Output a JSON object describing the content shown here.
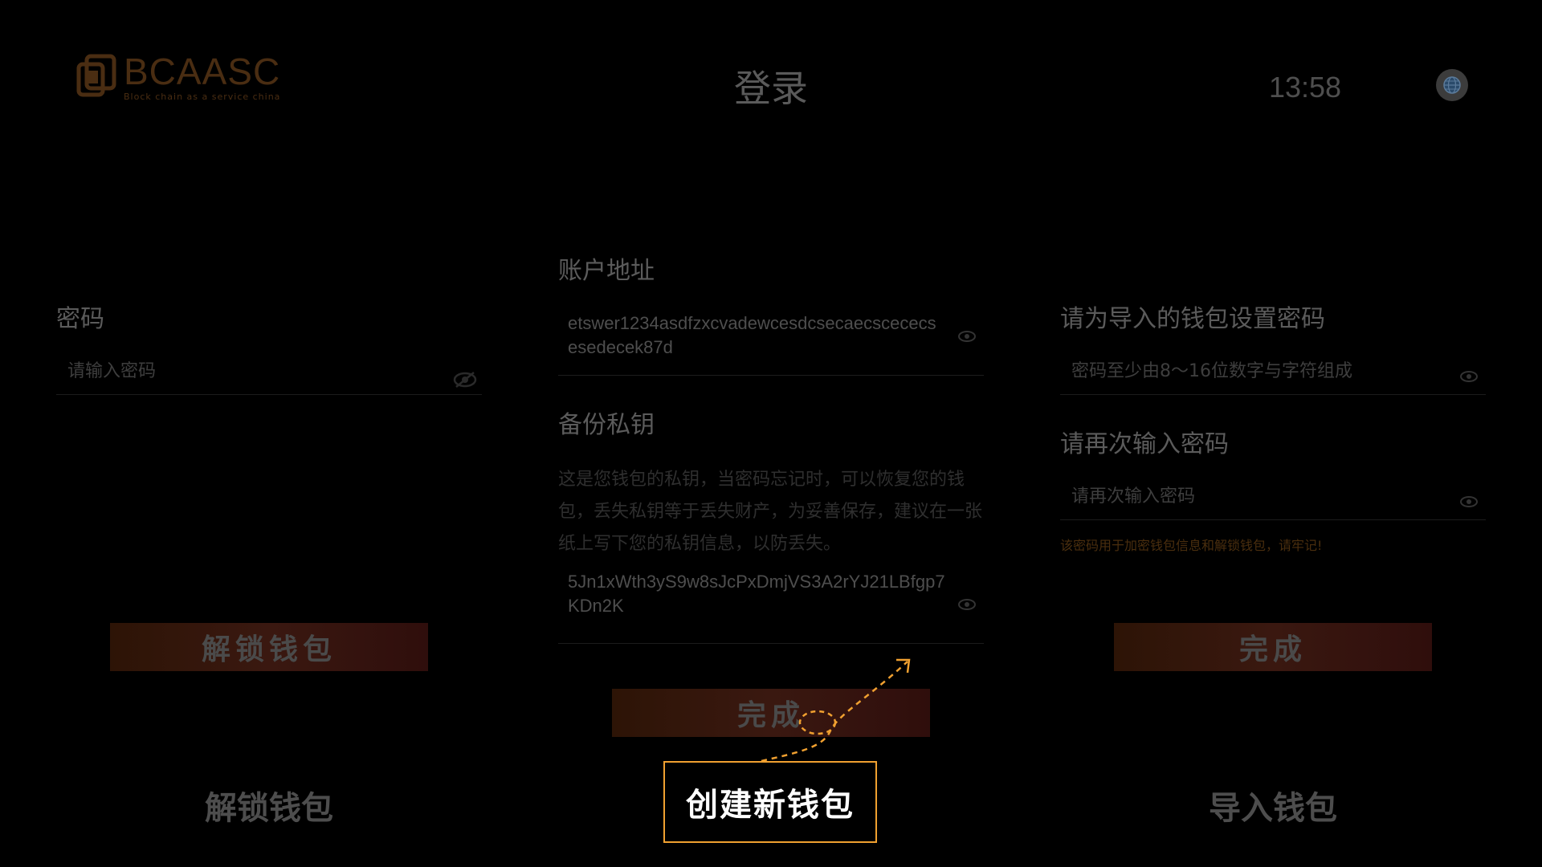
{
  "header": {
    "logo_name": "BCAASC",
    "logo_tagline": "Block chain as a service china",
    "title": "登录",
    "time": "13:58",
    "language_icon": "globe-icon"
  },
  "unlock_panel": {
    "password_label": "密码",
    "password_placeholder": "请输入密码",
    "unlock_button": "解锁钱包"
  },
  "create_panel": {
    "address_label": "账户地址",
    "address_value": "etswer1234asdfzxcvadewcesdcsecaecscececsesedecek87d",
    "backup_label": "备份私钥",
    "backup_description": "这是您钱包的私钥，当密码忘记时，可以恢复您的钱包，丢失私钥等于丢失财产，为妥善保存，建议在一张纸上写下您的私钥信息，以防丢失。",
    "private_key_value": "5Jn1xWth3yS9w8sJcPxDmjVS3A2rYJ21LBfgp7KDn2K",
    "done_button": "完成"
  },
  "import_panel": {
    "set_password_label": "请为导入的钱包设置密码",
    "password_placeholder": "密码至少由8～16位数字与字符组成",
    "confirm_label": "请再次输入密码",
    "confirm_placeholder": "请再次输入密码",
    "warning": "该密码用于加密钱包信息和解锁钱包，请牢记!",
    "done_button": "完成"
  },
  "tabs": {
    "unlock": "解锁钱包",
    "create": "创建新钱包",
    "import": "导入钱包"
  },
  "colors": {
    "focus_border": "#f0a030",
    "hint_arrow": "#f0a030",
    "button_bg": "#3a1810"
  }
}
